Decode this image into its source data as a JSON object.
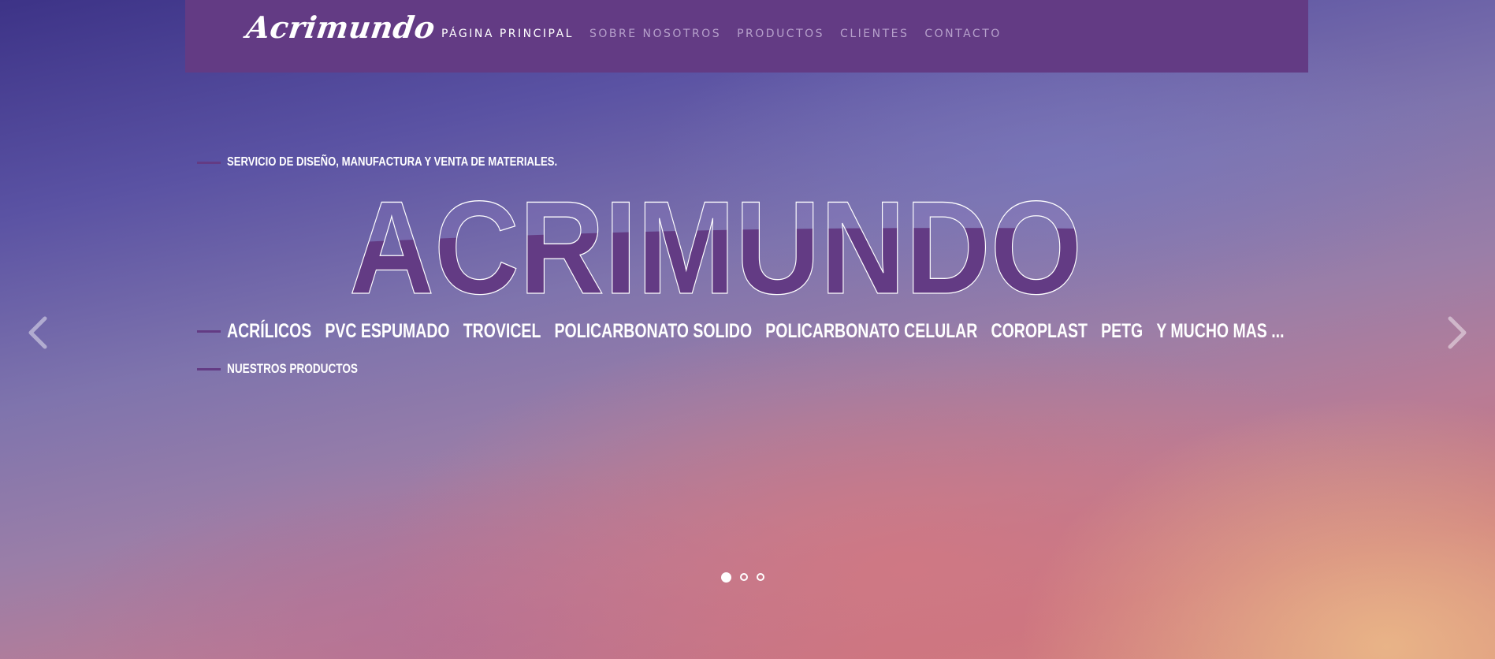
{
  "header": {
    "logo_text": "Acrimundo",
    "nav": [
      {
        "label": "PÁGINA PRINCIPAL",
        "active": true
      },
      {
        "label": "SOBRE NOSOTROS",
        "active": false
      },
      {
        "label": "PRODUCTOS",
        "active": false
      },
      {
        "label": "CLIENTES",
        "active": false
      },
      {
        "label": "CONTACTO",
        "active": false
      }
    ]
  },
  "hero": {
    "tagline": "SERVICIO DE DISEÑO, MANUFACTURA Y VENTA DE MATERIALES.",
    "title": "ACRIMUNDO",
    "products": [
      "ACRÍLICOS",
      "PVC ESPUMADO",
      "TROVICEL",
      "POLICARBONATO SOLIDO",
      "POLICARBONATO CELULAR",
      "COROPLAST",
      "PETG",
      "Y MUCHO MAS ..."
    ],
    "cta": "NUESTROS PRODUCTOS"
  },
  "slider": {
    "prev_icon": "chevron-left-icon",
    "next_icon": "chevron-right-icon",
    "dots": 3,
    "active_dot": 1
  },
  "colors": {
    "accent": "#633b84",
    "text": "#ffffff",
    "nav_inactive": "#b6a0cb"
  }
}
